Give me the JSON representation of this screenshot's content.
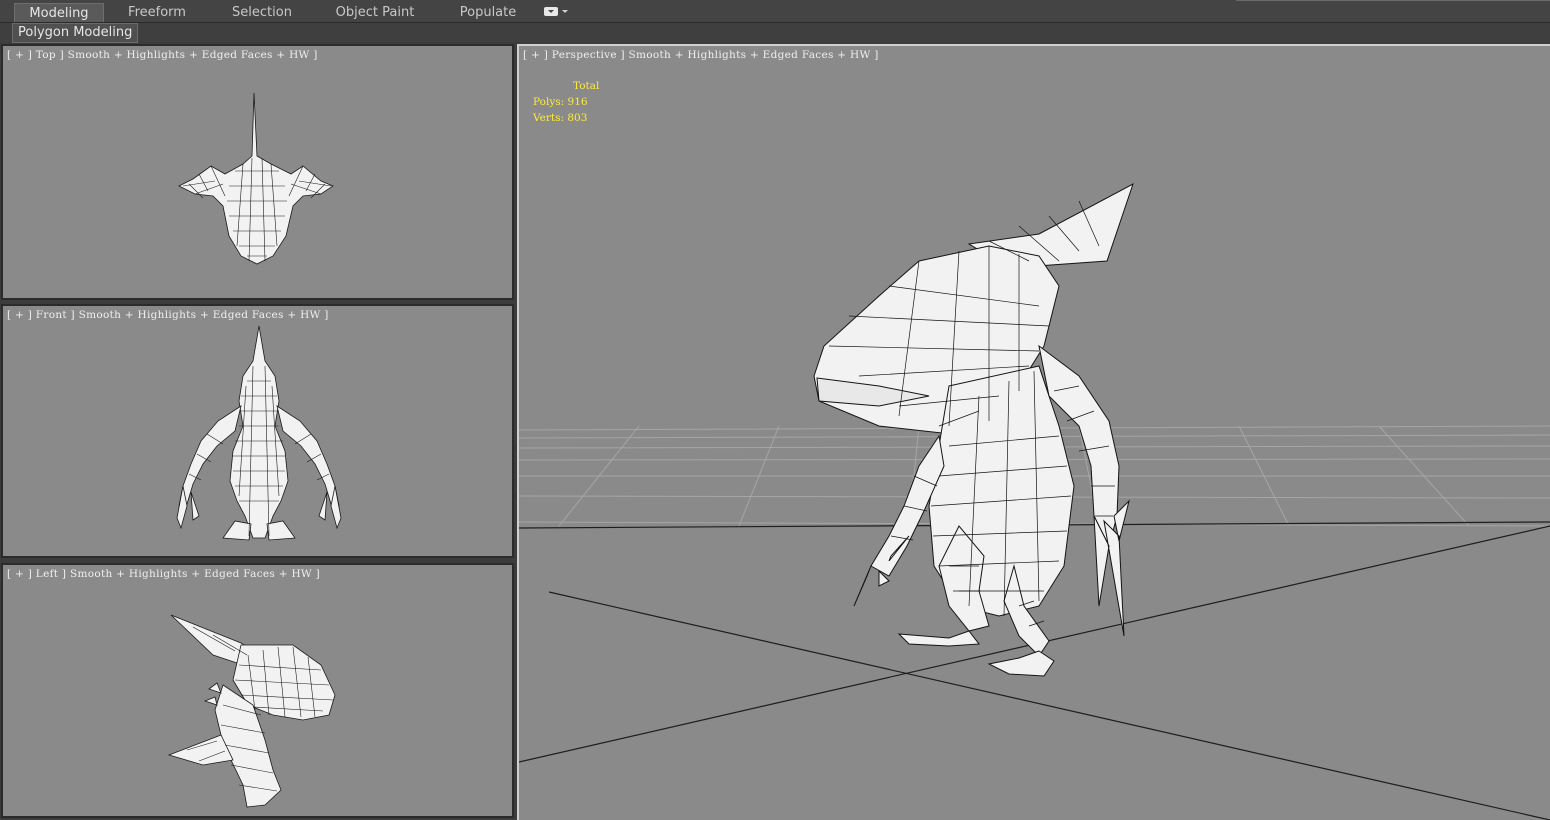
{
  "ribbon": {
    "tabs": [
      {
        "label": "Modeling",
        "active": true
      },
      {
        "label": "Freeform",
        "active": false
      },
      {
        "label": "Selection",
        "active": false
      },
      {
        "label": "Object Paint",
        "active": false
      },
      {
        "label": "Populate",
        "active": false
      }
    ],
    "panel_label": "Polygon Modeling"
  },
  "viewports": {
    "top": {
      "label": "[ + ] Top ] Smooth + Highlights + Edged Faces + HW ]"
    },
    "front": {
      "label": "[ + ] Front ] Smooth + Highlights + Edged Faces + HW ]"
    },
    "left": {
      "label": "[ + ] Left ] Smooth + Highlights + Edged Faces + HW ]"
    },
    "perspective": {
      "label": "[ + ] Perspective ] Smooth + Highlights + Edged Faces + HW ]"
    }
  },
  "stats": {
    "header": "Total",
    "polys": "Polys: 916",
    "verts": "Verts: 803"
  },
  "colors": {
    "viewport_bg": "#8a8a8a",
    "stats_text": "#ffeb3b",
    "active_border": "#d0d0d0",
    "mesh_fill": "#f2f2f2",
    "mesh_edge": "#1a1a1a"
  }
}
